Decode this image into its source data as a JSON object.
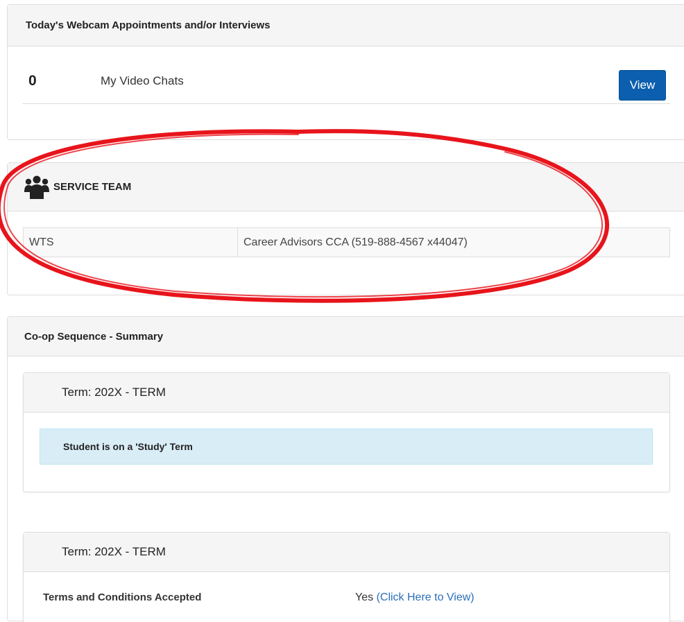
{
  "webcam_panel": {
    "title": "Today's Webcam Appointments and/or Interviews",
    "count": "0",
    "label": "My Video Chats",
    "view_button": "View"
  },
  "service_team": {
    "icon": "users-icon",
    "title": "SERVICE TEAM",
    "rows": [
      {
        "team": "WTS",
        "contact": "Career Advisors CCA (519-888-4567 x44047)"
      }
    ]
  },
  "coop_panel": {
    "title": "Co-op Sequence - Summary",
    "terms": [
      {
        "heading": "Term: 202X - TERM",
        "message": "Student is on a 'Study' Term"
      },
      {
        "heading": "Term: 202X - TERM",
        "field_label": "Terms and Conditions Accepted",
        "field_value": "Yes",
        "link_text": "(Click Here to View)"
      }
    ]
  },
  "annotation": {
    "color": "#e8141b"
  },
  "colors": {
    "primary_button": "#0b5fae",
    "link": "#2a6ebb",
    "info_bg": "#d9edf7"
  }
}
